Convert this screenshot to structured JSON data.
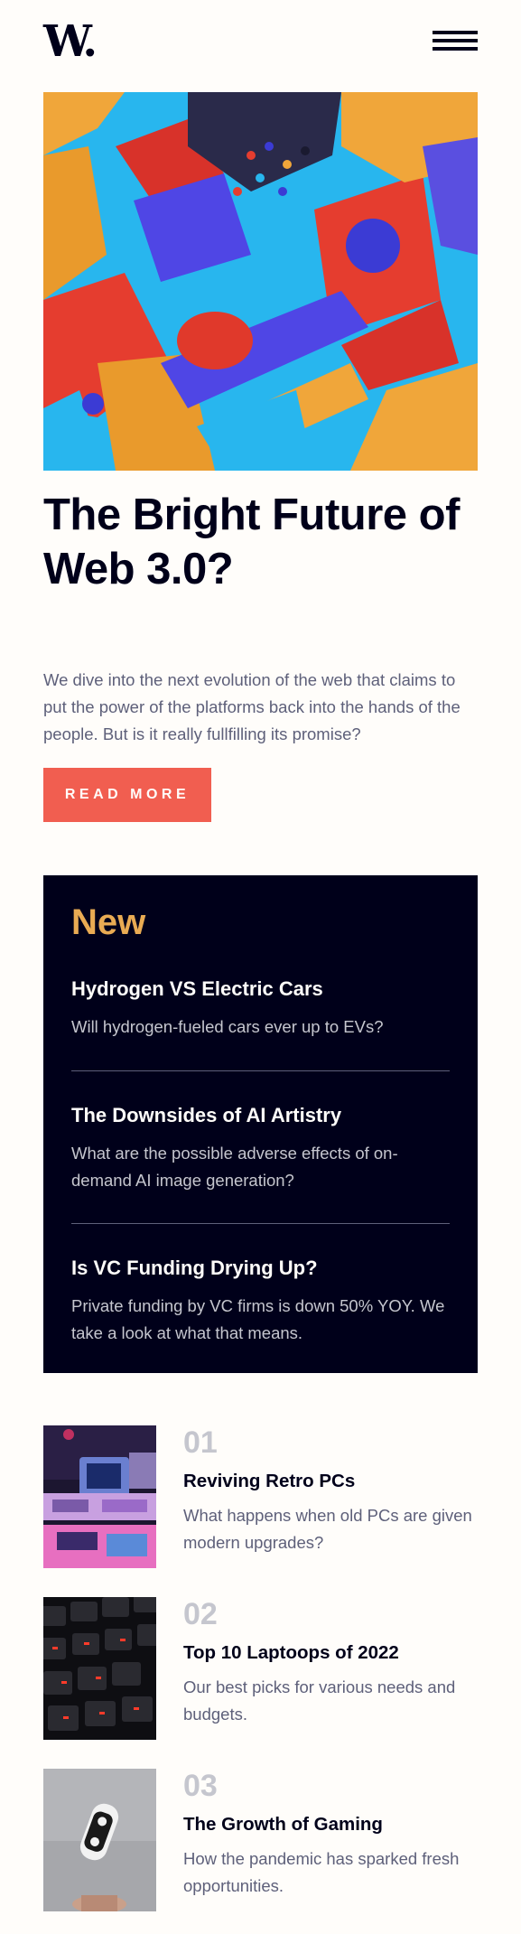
{
  "header": {
    "logo": "W.",
    "menu_icon": "hamburger-menu-icon"
  },
  "hero": {
    "image_icon": "abstract-3d-shapes-image",
    "title": "The Bright Future of Web 3.0?",
    "description": "We dive into the next evolution of the web that claims to put the power of the platforms back into the hands of the people. But is it really fullfilling its promise?",
    "button_label": "READ MORE"
  },
  "new_panel": {
    "heading": "New",
    "items": [
      {
        "title": "Hydrogen VS Electric Cars",
        "description": "Will hydrogen-fueled cars ever up to EVs?"
      },
      {
        "title": "The Downsides of AI Artistry",
        "description": "What are the possible adverse effects of on-demand AI image generation?"
      },
      {
        "title": "Is VC Funding Drying Up?",
        "description": "Private funding by VC firms is down 50% YOY. We take a look at what that means."
      }
    ]
  },
  "articles": [
    {
      "number": "01",
      "title": "Reviving Retro PCs",
      "description": "What happens when old PCs are given modern upgrades?",
      "image_icon": "retro-pcs-image"
    },
    {
      "number": "02",
      "title": "Top 10 Laptoops of 2022",
      "description": "Our best picks for various needs and budgets.",
      "image_icon": "keyboard-image"
    },
    {
      "number": "03",
      "title": "The Growth of Gaming",
      "description": "How the pandemic has sparked fresh opportunities.",
      "image_icon": "gamepad-image"
    }
  ],
  "colors": {
    "accent_red": "#f15e50",
    "accent_orange": "#e9ab53",
    "dark_navy": "#00001a",
    "grayish_blue": "#5e607a",
    "off_white": "#fffdfa"
  }
}
